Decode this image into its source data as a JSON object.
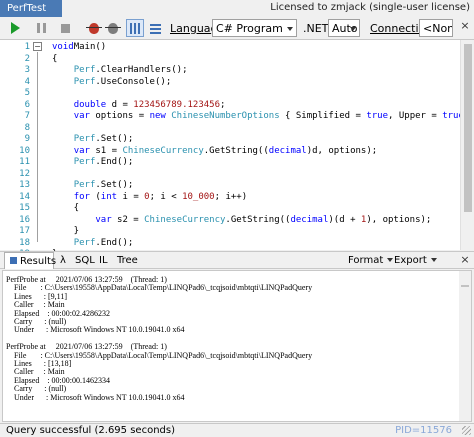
{
  "titlebar": {
    "tab": "PerfTest",
    "license": "Licensed to zmjack (single-user license)"
  },
  "toolbar": {
    "language_label": "Language",
    "language_value": "C# Program",
    "net_label": ".NET",
    "net_value": "Auto",
    "connection_label": "Connection",
    "connection_value": "<None"
  },
  "editor": {
    "line_numbers": [
      "1",
      "2",
      "3",
      "4",
      "5",
      "6",
      "7",
      "8",
      "9",
      "10",
      "11",
      "12",
      "13",
      "14",
      "15",
      "16",
      "17",
      "18",
      "19",
      "20",
      "21"
    ],
    "lines": [
      [
        [
          "kw",
          "void"
        ],
        [
          "",
          "Main()"
        ]
      ],
      [
        [
          "",
          "{"
        ]
      ],
      [
        [
          "",
          "    "
        ],
        [
          "ty",
          "Perf"
        ],
        [
          "",
          ".ClearHandlers();"
        ]
      ],
      [
        [
          "",
          "    "
        ],
        [
          "ty",
          "Perf"
        ],
        [
          "",
          ".UseConsole();"
        ]
      ],
      [
        [
          "",
          ""
        ]
      ],
      [
        [
          "",
          "    "
        ],
        [
          "kw",
          "double"
        ],
        [
          "",
          " d = "
        ],
        [
          "num",
          "123456789.123456"
        ],
        [
          "",
          ";"
        ]
      ],
      [
        [
          "",
          "    "
        ],
        [
          "kw",
          "var"
        ],
        [
          "",
          " options = "
        ],
        [
          "kw",
          "new"
        ],
        [
          "",
          ""
        ],
        [
          "ty",
          " ChineseNumberOptions"
        ],
        [
          "",
          " { Simplified = "
        ],
        [
          "kw",
          "true"
        ],
        [
          "",
          ", Upper = "
        ],
        [
          "kw",
          "true"
        ],
        [
          "",
          " };"
        ]
      ],
      [
        [
          "",
          ""
        ]
      ],
      [
        [
          "",
          "    "
        ],
        [
          "ty",
          "Perf"
        ],
        [
          "",
          ".Set();"
        ]
      ],
      [
        [
          "",
          "    "
        ],
        [
          "kw",
          "var"
        ],
        [
          "",
          " s1 = "
        ],
        [
          "ty",
          "ChineseCurrency"
        ],
        [
          "",
          ".GetString(("
        ],
        [
          "kw",
          "decimal"
        ],
        [
          "",
          ")d, options);"
        ]
      ],
      [
        [
          "",
          "    "
        ],
        [
          "ty",
          "Perf"
        ],
        [
          "",
          ".End();"
        ]
      ],
      [
        [
          "",
          ""
        ]
      ],
      [
        [
          "",
          "    "
        ],
        [
          "ty",
          "Perf"
        ],
        [
          "",
          ".Set();"
        ]
      ],
      [
        [
          "",
          "    "
        ],
        [
          "kw",
          "for"
        ],
        [
          "",
          " ("
        ],
        [
          "kw",
          "int"
        ],
        [
          "",
          " i = "
        ],
        [
          "num",
          "0"
        ],
        [
          "",
          "; i < "
        ],
        [
          "num",
          "10_000"
        ],
        [
          "",
          "; i++)"
        ]
      ],
      [
        [
          "",
          "    {"
        ]
      ],
      [
        [
          "",
          "        "
        ],
        [
          "kw",
          "var"
        ],
        [
          "",
          " s2 = "
        ],
        [
          "ty",
          "ChineseCurrency"
        ],
        [
          "",
          ".GetString(("
        ],
        [
          "kw",
          "decimal"
        ],
        [
          "",
          ")(d + "
        ],
        [
          "num",
          "1"
        ],
        [
          "",
          "), options);"
        ]
      ],
      [
        [
          "",
          "    }"
        ]
      ],
      [
        [
          "",
          "    "
        ],
        [
          "ty",
          "Perf"
        ],
        [
          "",
          ".End();"
        ]
      ],
      [
        [
          "",
          "}"
        ]
      ]
    ]
  },
  "result_tabs": {
    "results": "Results",
    "lambda": "λ",
    "sql": "SQL",
    "il": "IL",
    "tree": "Tree",
    "format": "Format",
    "export": "Export"
  },
  "output": {
    "lines": [
      "PerfProbe at     2021/07/06 13:27:59    (Thread: 1)",
      "    File       : C:\\Users\\19558\\AppData\\Local\\Temp\\LINQPad6\\_tcqjsoid\\mbtqti\\LINQPadQuery",
      "    Lines      : [9,11]",
      "    Caller     : Main",
      "    Elapsed    : 00:00:02.4286232",
      "    Carry      : (null)",
      "    Under      : Microsoft Windows NT 10.0.19041.0 x64",
      "",
      "PerfProbe at     2021/07/06 13:27:59    (Thread: 1)",
      "    File       : C:\\Users\\19558\\AppData\\Local\\Temp\\LINQPad6\\_tcqjsoid\\mbtqti\\LINQPadQuery",
      "    Lines      : [13,18]",
      "    Caller     : Main",
      "    Elapsed    : 00:00:00.1462334",
      "    Carry      : (null)",
      "    Under      : Microsoft Windows NT 10.0.19041.0 x64"
    ]
  },
  "status": {
    "message": "Query successful  (2.695 seconds)",
    "pid": "PID=11576"
  },
  "colors": {
    "keyword": "#0000ff",
    "type": "#2b91af",
    "number": "#a31515",
    "tab_accent": "#4a7ab5"
  }
}
